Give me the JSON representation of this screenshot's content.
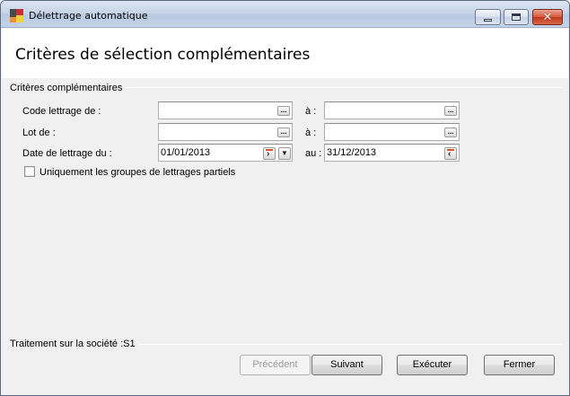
{
  "window": {
    "title": "Délettrage automatique",
    "controls": {
      "minimize": "minimize",
      "maximize": "maximize",
      "close": "✕"
    }
  },
  "page": {
    "title": "Critères de sélection complémentaires"
  },
  "criteria": {
    "legend": "Critères complémentaires",
    "rows": [
      {
        "label": "Code lettrage de :",
        "from_value": "",
        "to_label": "à :",
        "to_value": ""
      },
      {
        "label": "Lot de :",
        "from_value": "",
        "to_label": "à :",
        "to_value": ""
      },
      {
        "label": "Date de lettrage du :",
        "from_value": "01/01/2013",
        "to_label": "au :",
        "to_value": "31/12/2013"
      }
    ],
    "ellipsis": "...",
    "partial_groups_checkbox": {
      "label": "Uniquement les groupes de lettrages partiels",
      "checked": false
    }
  },
  "status": {
    "text": "Traitement sur la société :S1"
  },
  "buttons": {
    "previous": "Précédent",
    "next": "Suivant",
    "execute": "Exécuter",
    "close": "Fermer"
  },
  "colors": {
    "title_bar": "#c7d5e8",
    "close_button": "#c1381c",
    "panel": "#f0f0f0",
    "header": "#ffffff"
  }
}
